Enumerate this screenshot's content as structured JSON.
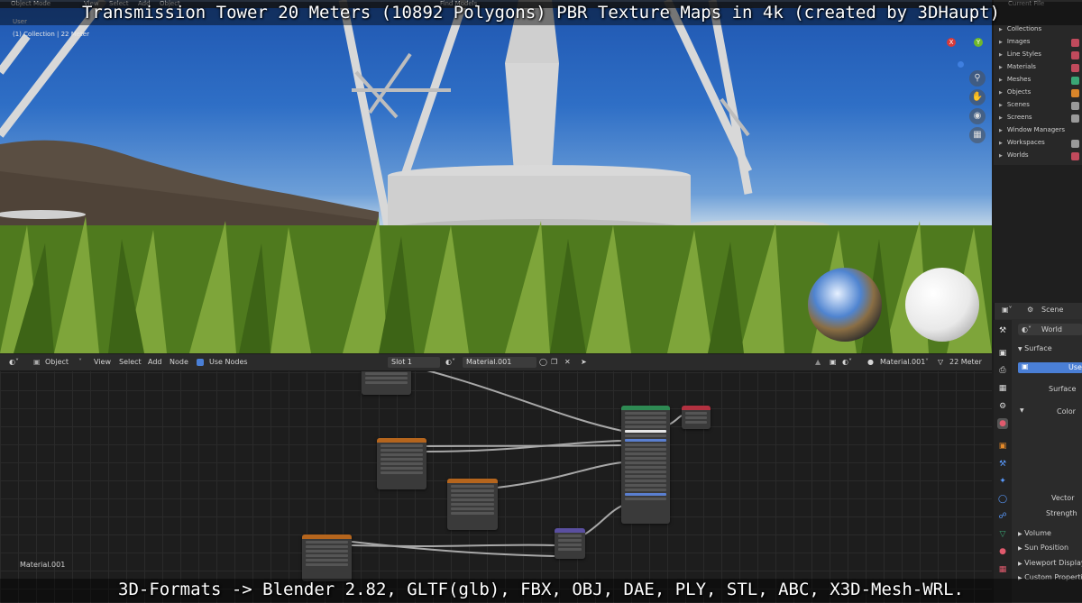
{
  "captions": {
    "top": "Transmission Tower 20 Meters (10892 Polygons) PBR Texture Maps in 4k (created by 3DHaupt)",
    "bottom": "3D-Formats -> Blender 2.82, GLTF(glb), FBX, OBJ, DAE, PLY, STL, ABC, X3D-Mesh-WRL."
  },
  "viewport": {
    "mode": "Object Mode",
    "menus": [
      "View",
      "Select",
      "Add",
      "Object"
    ],
    "find_models": "Find Models",
    "user_label": "User",
    "collection_info": "(1) Collection | 22 Meter",
    "gizmo_x": "X",
    "gizmo_y": "Y"
  },
  "node_editor": {
    "editor_type": "Object",
    "menus": [
      "View",
      "Select",
      "Add",
      "Node"
    ],
    "use_nodes_label": "Use Nodes",
    "slot": "Slot 1",
    "material": "Material.001",
    "material_right": "Material.001",
    "object_name": "22 Meter",
    "footer_material": "Material.001"
  },
  "outliner": {
    "header": "Current File",
    "items": [
      "Collections",
      "Images",
      "Line Styles",
      "Materials",
      "Meshes",
      "Objects",
      "Scenes",
      "Screens",
      "Window Managers",
      "Workspaces",
      "Worlds"
    ]
  },
  "properties": {
    "scene_label": "Scene",
    "world_label": "World",
    "surface_panel": "Surface",
    "use_button": "Use",
    "surface_field": "Surface",
    "color_field": "Color",
    "vector_field": "Vector",
    "strength_field": "Strength",
    "volume_panel": "Volume",
    "sun_position_panel": "Sun Position",
    "viewport_display_panel": "Viewport Display",
    "custom_properties_panel": "Custom Properties"
  },
  "colors": {
    "accent": "#4a7fd6",
    "node_header_orange": "#b5651d",
    "node_header_green": "#2e8a53",
    "node_header_red": "#b23140",
    "node_header_purple": "#5a4fa0"
  }
}
